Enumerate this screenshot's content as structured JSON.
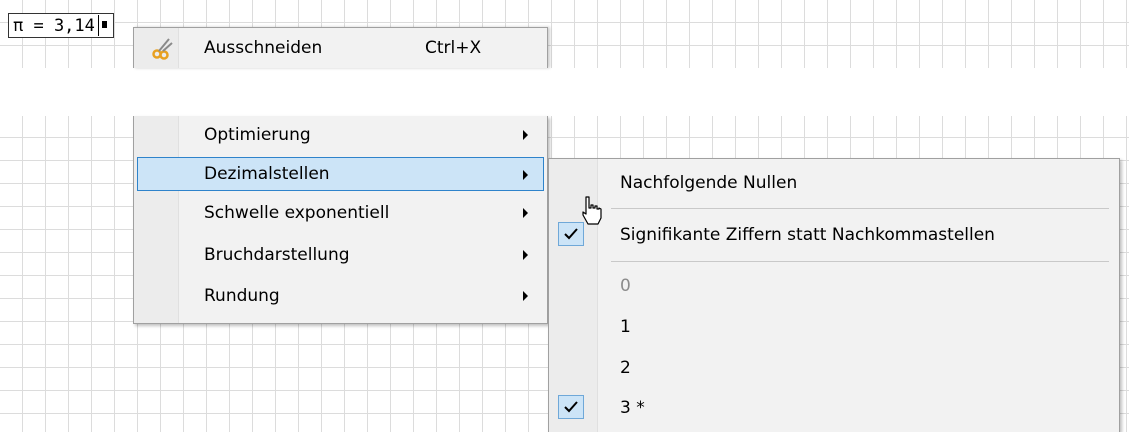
{
  "math": {
    "expression": "π = 3,14"
  },
  "context_menu": {
    "cut": {
      "label": "Ausschneiden",
      "shortcut": "Ctrl+X"
    },
    "items": [
      {
        "label": "Optimierung"
      },
      {
        "label": "Dezimalstellen"
      },
      {
        "label": "Schwelle exponentiell"
      },
      {
        "label": "Bruchdarstellung"
      },
      {
        "label": "Rundung"
      }
    ]
  },
  "submenu": {
    "trailing_zeros": "Nachfolgende Nullen",
    "significant_digits": "Signifikante Ziffern statt Nachkommastellen",
    "options": [
      "0",
      "1",
      "2",
      "3 *"
    ]
  },
  "colors": {
    "highlight_bg": "#cce4f7",
    "highlight_border": "#2e83cb",
    "menu_bg": "#f2f2f2"
  }
}
